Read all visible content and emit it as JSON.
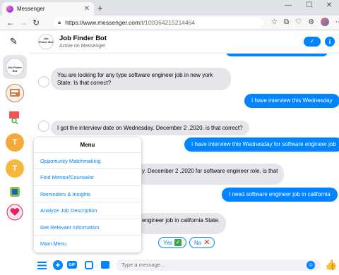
{
  "browser": {
    "tab_title": "Messenger",
    "tab_close": "✕",
    "new_tab": "+",
    "window_controls": [
      "—",
      "☐",
      "✕"
    ],
    "nav": {
      "back": "←",
      "forward": "→",
      "reload": "↻"
    },
    "url_prefix": "https://www.messenger.com",
    "url_path": "/t/100364215214464",
    "toolbar_icons": [
      "☆",
      "⧉",
      "♡",
      "⚙"
    ],
    "more": "⋯"
  },
  "rail": {
    "compose_icon": "✎",
    "bot_avatar_text": "Job Finder Bot",
    "t_avatar_1": "T",
    "t_avatar_2": "T"
  },
  "header": {
    "name": "Job Finder Bot",
    "status": "Active on Messenger",
    "avatar_text": "Job Finder Bot",
    "check_icon": "✓",
    "info_icon": "i"
  },
  "messages": [
    {
      "from": "bot",
      "text": "You are looking for any type software engineer job in new york State. Is that correct?"
    },
    {
      "from": "user",
      "text": "I have interview this Wednesday"
    },
    {
      "from": "bot",
      "text": "I got the interview date on Wednesday. December 2 ,2020. is that correct?"
    },
    {
      "from": "user",
      "text": "I have interview this Wednesday for software engineer job"
    },
    {
      "from": "bot",
      "text": "y. December 2 ,2020 for software engineer role. is that"
    },
    {
      "from": "user",
      "text": "I need software engineer job in california"
    },
    {
      "from": "bot",
      "text": "engineer job in california State."
    }
  ],
  "quick_replies": [
    {
      "label": "Yes",
      "icon": "✓"
    },
    {
      "label": "No",
      "icon": "✕"
    }
  ],
  "menu": {
    "title": "Menu",
    "items": [
      "Opportunity Matchmaking",
      "Find Mentor/Counselor",
      "Reminders & Insights",
      "Analyze Job Description",
      "Get Relevant Information",
      "Main Menu"
    ]
  },
  "composer": {
    "placeholder": "Type a message...",
    "gif_label": "GIF",
    "plus_icon": "+",
    "emoji_icon": "☺",
    "like_icon": "👍"
  },
  "colors": {
    "accent": "#0084ff",
    "incoming_bubble": "#e4e6eb",
    "yes_icon": "#3aa84a",
    "no_icon": "#d93025"
  }
}
